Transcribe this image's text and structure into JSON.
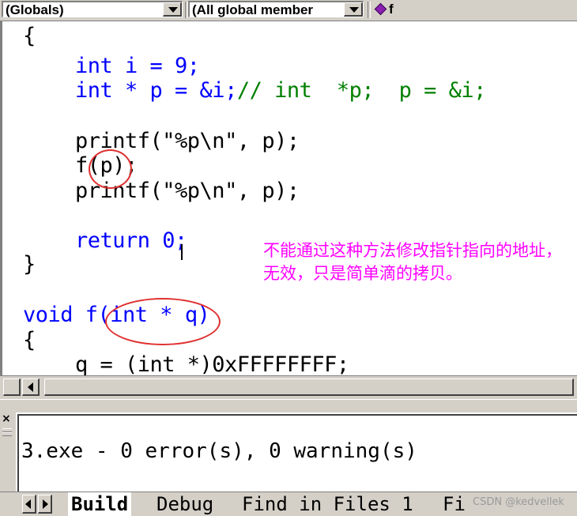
{
  "toolbar": {
    "scope_combo": "(Globals)",
    "members_combo": "(All global member",
    "function_name": "f",
    "function_icon": "diamond-icon"
  },
  "editor": {
    "lines": [
      "{",
      "int i = 9;",
      "int * p = &i;",
      "// int  *p;  p = &i;",
      "printf(\"%p\\n\", p);",
      "f(p);",
      "printf(\"%p\\n\", p);",
      "return 0;",
      "}",
      "void f(int * q)",
      "{",
      "q = (int *)0xFFFFFFFF;"
    ],
    "annotation": "不能通过这种方法修改指针指向的地址，无效，只是简单滴的拷贝。",
    "colors": {
      "keyword": "#0000ff",
      "comment": "#008000",
      "annotation": "#ff00ff",
      "circle": "#e03030"
    }
  },
  "output": {
    "text": "3.exe - 0 error(s), 0 warning(s)"
  },
  "tabs": [
    {
      "label": "Build"
    },
    {
      "label": "Debug"
    },
    {
      "label": "Find in Files 1"
    },
    {
      "label": "Fi"
    }
  ],
  "watermark": "CSDN @kedvellek"
}
